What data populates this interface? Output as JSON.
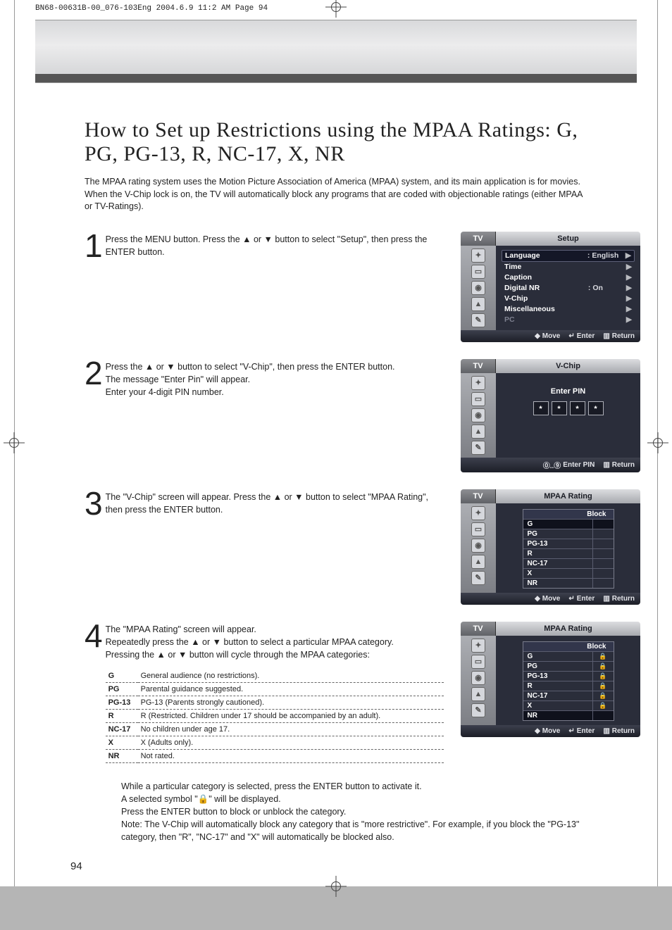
{
  "print_header": "BN68-00631B-00_076-103Eng  2004.6.9  11:2 AM  Page 94",
  "title": "How to Set up Restrictions using the MPAA Ratings: G, PG, PG-13, R, NC-17, X, NR",
  "intro": "The MPAA rating system uses the Motion Picture Association of America (MPAA) system, and its main application is for movies. When the V-Chip lock is on, the TV will automatically block any programs that are coded with objectionable ratings (either MPAA or TV-Ratings).",
  "page_num": "94",
  "steps": {
    "s1": {
      "num": "1",
      "text": "Press the MENU button. Press the ▲ or ▼ button to select \"Setup\", then press the ENTER button."
    },
    "s2": {
      "num": "2",
      "text": "Press the ▲ or ▼ button to select \"V-Chip\", then press the ENTER button.\nThe message \"Enter Pin\" will appear.\nEnter your 4-digit PIN number."
    },
    "s3": {
      "num": "3",
      "text": "The \"V-Chip\" screen will appear. Press the ▲ or ▼ button to select \"MPAA Rating\", then press the ENTER button."
    },
    "s4": {
      "num": "4",
      "text": "The \"MPAA Rating\" screen will appear.\nRepeatedly press the ▲ or ▼ button to select a particular MPAA category.\nPressing the ▲ or ▼ button will cycle through the MPAA categories:"
    }
  },
  "osd": {
    "tv": "TV",
    "move": "Move",
    "enter": "Enter",
    "ret": "Return",
    "enterpin": "Enter PIN",
    "setup": {
      "title": "Setup",
      "items": [
        {
          "label": "Language",
          "value": ": English",
          "sel": true
        },
        {
          "label": "Time",
          "value": "",
          "sel": false
        },
        {
          "label": "Caption",
          "value": "",
          "sel": false
        },
        {
          "label": "Digital NR",
          "value": ": On",
          "sel": false
        },
        {
          "label": "V-Chip",
          "value": "",
          "sel": false
        },
        {
          "label": "Miscellaneous",
          "value": "",
          "sel": false
        },
        {
          "label": "PC",
          "value": "",
          "sel": false,
          "dim": true
        }
      ]
    },
    "vchip": {
      "title": "V-Chip",
      "label": "Enter PIN",
      "star": "*"
    },
    "mpaa": {
      "title": "MPAA Rating",
      "block": "Block",
      "rows": [
        "G",
        "PG",
        "PG-13",
        "R",
        "NC-17",
        "X",
        "NR"
      ]
    }
  },
  "rating_defs": [
    {
      "code": "G",
      "desc": "General audience (no restrictions)."
    },
    {
      "code": "PG",
      "desc": "Parental guidance suggested."
    },
    {
      "code": "PG-13",
      "desc": "PG-13 (Parents strongly cautioned)."
    },
    {
      "code": "R",
      "desc": "R (Restricted. Children under 17 should be accompanied by an adult)."
    },
    {
      "code": "NC-17",
      "desc": "No children under age 17."
    },
    {
      "code": "X",
      "desc": "X (Adults only)."
    },
    {
      "code": "NR",
      "desc": "Not rated."
    }
  ],
  "after": "While a particular category is selected, press the ENTER button to activate it.\nA selected symbol \"🔒\" will be displayed.\nPress the ENTER button to block or unblock the category.\nNote: The V-Chip will automatically block any category that is \"more restrictive\". For example, if you block the \"PG-13\" category, then \"R\", \"NC-17\" and \"X\" will automatically be blocked also."
}
